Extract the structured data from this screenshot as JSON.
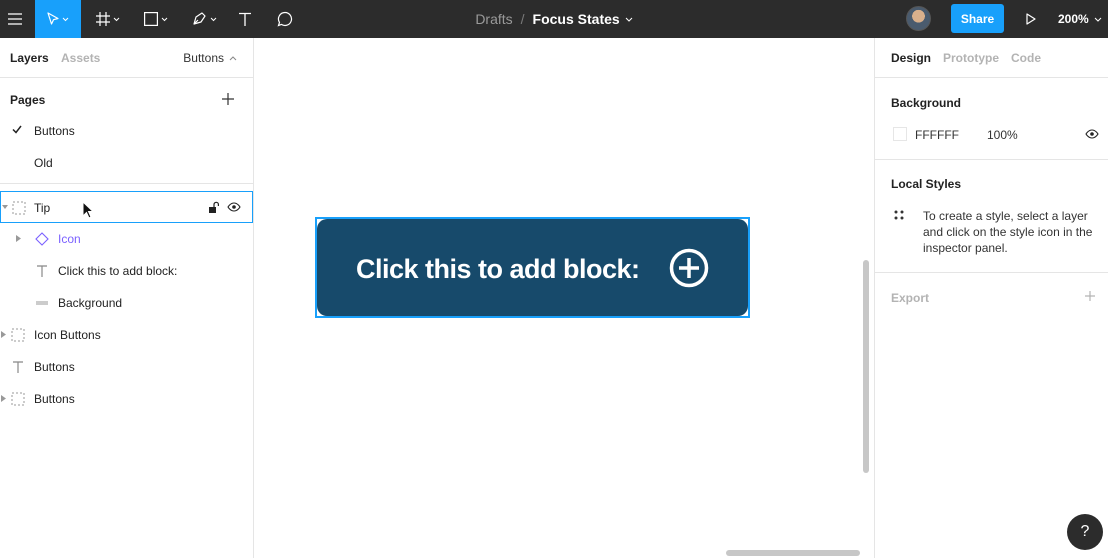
{
  "toolbar": {
    "breadcrumb": "Drafts",
    "separator": "/",
    "file_name": "Focus States",
    "share_label": "Share",
    "zoom": "200%"
  },
  "left_panel": {
    "tabs": [
      "Layers",
      "Assets"
    ],
    "current_page": "Buttons",
    "pages_header": "Pages",
    "pages": [
      {
        "label": "Buttons",
        "selected": true
      },
      {
        "label": "Old",
        "selected": false
      }
    ],
    "layers": [
      {
        "label": "Tip",
        "type": "frame",
        "selected": true
      },
      {
        "label": "Icon",
        "type": "component-instance"
      },
      {
        "label": "Click this to add block:",
        "type": "text"
      },
      {
        "label": "Background",
        "type": "rectangle"
      },
      {
        "label": "Icon Buttons",
        "type": "frame"
      },
      {
        "label": "Buttons",
        "type": "text"
      },
      {
        "label": "Buttons",
        "type": "frame"
      }
    ]
  },
  "canvas": {
    "tip_text": "Click this to add block:",
    "tip_color": "#174a6b",
    "selection_color": "#18a0fb"
  },
  "right_panel": {
    "tabs": [
      "Design",
      "Prototype",
      "Code"
    ],
    "background_title": "Background",
    "background_hex": "FFFFFF",
    "background_opacity": "100%",
    "local_styles_title": "Local Styles",
    "local_styles_note": "To create a style, select a layer and click on the style icon in the inspector panel.",
    "export_title": "Export",
    "help_label": "?"
  },
  "colors": {
    "accent": "#18a0fb",
    "toolbar_bg": "#2c2c2c",
    "component_purple": "#7b61ff"
  }
}
